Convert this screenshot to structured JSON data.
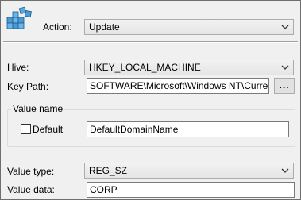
{
  "action": {
    "label": "Action:",
    "value": "Update"
  },
  "hive": {
    "label": "Hive:",
    "value": "HKEY_LOCAL_MACHINE"
  },
  "key_path": {
    "label": "Key Path:",
    "value": "SOFTWARE\\Microsoft\\Windows NT\\CurrentVersion\\Winlogon",
    "browse_label": "..."
  },
  "value_name": {
    "group_label": "Value name",
    "default_label": "Default",
    "default_checked": false,
    "value": "DefaultDomainName"
  },
  "value_type": {
    "label": "Value type:",
    "value": "REG_SZ"
  },
  "value_data": {
    "label": "Value data:",
    "value": "CORP"
  },
  "icons": {
    "header": "registry-editor-icon",
    "dropdown": "chevron-down-icon"
  }
}
